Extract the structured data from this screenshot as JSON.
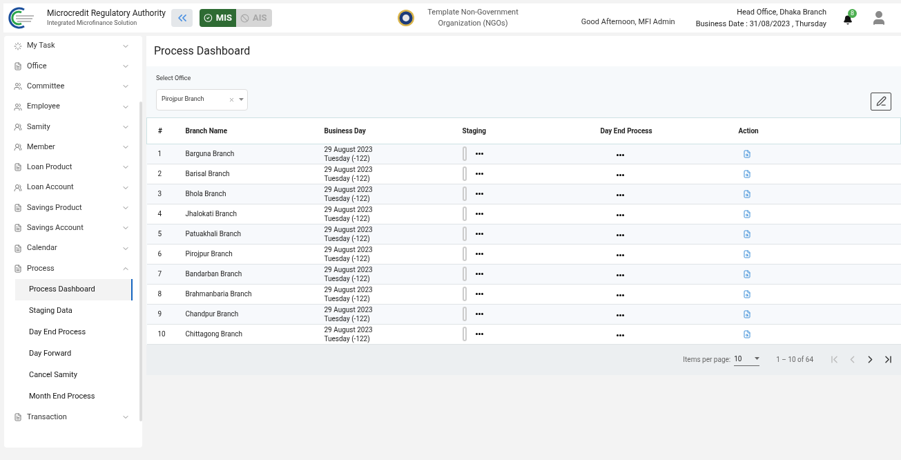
{
  "header": {
    "org_name": "Microcredit Regulatory Authority",
    "org_subtitle": "Integrated Microfinance Solution",
    "modules": [
      {
        "label": "MIS",
        "selected": true
      },
      {
        "label": "AIS",
        "selected": false
      }
    ],
    "ngo_name": "Template Non-Government Organization (NGOs)",
    "greeting": "Good Afternoon, MFI Admin",
    "office": "Head Office, Dhaka Branch",
    "business_date": "Business Date : 31/08/2023 , Thursday",
    "notification_count": "8"
  },
  "sidebar": {
    "items": [
      {
        "label": "My Task",
        "expanded": false
      },
      {
        "label": "Office",
        "expanded": false
      },
      {
        "label": "Committee",
        "expanded": false
      },
      {
        "label": "Employee",
        "expanded": false
      },
      {
        "label": "Samity",
        "expanded": false
      },
      {
        "label": "Member",
        "expanded": false
      },
      {
        "label": "Loan Product",
        "expanded": false
      },
      {
        "label": "Loan Account",
        "expanded": false
      },
      {
        "label": "Savings Product",
        "expanded": false
      },
      {
        "label": "Savings Account",
        "expanded": false
      },
      {
        "label": "Calendar",
        "expanded": false
      },
      {
        "label": "Process",
        "expanded": true,
        "children": [
          {
            "label": "Process Dashboard",
            "selected": true
          },
          {
            "label": "Staging Data",
            "selected": false
          },
          {
            "label": "Day End Process",
            "selected": false
          },
          {
            "label": "Day Forward",
            "selected": false
          },
          {
            "label": "Cancel Samity",
            "selected": false
          },
          {
            "label": "Month End Process",
            "selected": false
          }
        ]
      },
      {
        "label": "Transaction",
        "expanded": false
      }
    ]
  },
  "page": {
    "title": "Process Dashboard",
    "filter": {
      "label": "Select Office",
      "value": "Pirojpur Branch"
    }
  },
  "table": {
    "columns": [
      "#",
      "Branch Name",
      "Business Day",
      "Staging",
      "Day End Process",
      "Action"
    ],
    "rows": [
      {
        "no": "1",
        "branch": "Barguna Branch",
        "date": "29 August 2023",
        "day": "Tuesday (-122)"
      },
      {
        "no": "2",
        "branch": "Barisal Branch",
        "date": "29 August 2023",
        "day": "Tuesday (-122)"
      },
      {
        "no": "3",
        "branch": "Bhola Branch",
        "date": "29 August 2023",
        "day": "Tuesday (-122)"
      },
      {
        "no": "4",
        "branch": "Jhalokati Branch",
        "date": "29 August 2023",
        "day": "Tuesday (-122)"
      },
      {
        "no": "5",
        "branch": "Patuakhali Branch",
        "date": "29 August 2023",
        "day": "Tuesday (-122)"
      },
      {
        "no": "6",
        "branch": "Pirojpur Branch",
        "date": "29 August 2023",
        "day": "Tuesday (-122)"
      },
      {
        "no": "7",
        "branch": "Bandarban Branch",
        "date": "29 August 2023",
        "day": "Tuesday (-122)"
      },
      {
        "no": "8",
        "branch": "Brahmanbaria Branch",
        "date": "29 August 2023",
        "day": "Tuesday (-122)"
      },
      {
        "no": "9",
        "branch": "Chandpur Branch",
        "date": "29 August 2023",
        "day": "Tuesday (-122)"
      },
      {
        "no": "10",
        "branch": "Chittagong Branch",
        "date": "29 August 2023",
        "day": "Tuesday (-122)"
      }
    ]
  },
  "paginator": {
    "items_label": "Items per page:",
    "page_size": "10",
    "range": "1 – 10 of 64"
  }
}
